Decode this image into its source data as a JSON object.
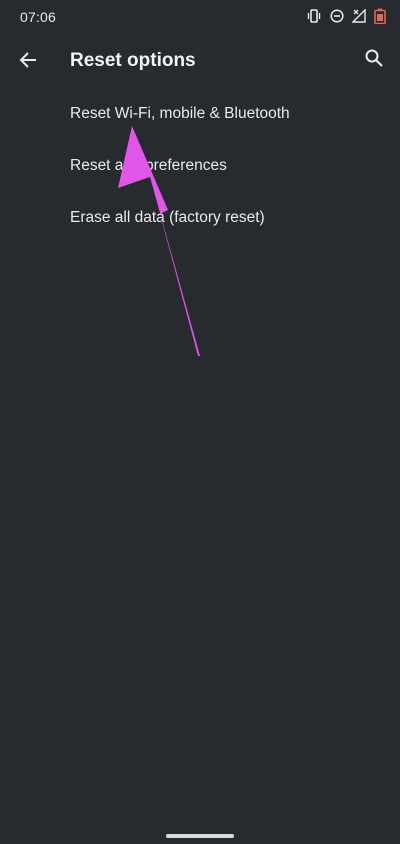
{
  "status_bar": {
    "time": "07:06",
    "icons": [
      "vibrate-icon",
      "do-not-disturb-icon",
      "no-signal-icon",
      "battery-low-icon"
    ]
  },
  "app_bar": {
    "title": "Reset options",
    "back_icon": "arrow-back-icon",
    "search_icon": "search-icon"
  },
  "options": [
    {
      "label": "Reset Wi-Fi, mobile & Bluetooth"
    },
    {
      "label": "Reset app preferences"
    },
    {
      "label": "Erase all data (factory reset)"
    }
  ],
  "annotation": {
    "type": "arrow",
    "color": "#E056E8"
  },
  "colors": {
    "background": "#272A2F",
    "text": "#E8EAED",
    "battery_accent": "#E2675A"
  }
}
